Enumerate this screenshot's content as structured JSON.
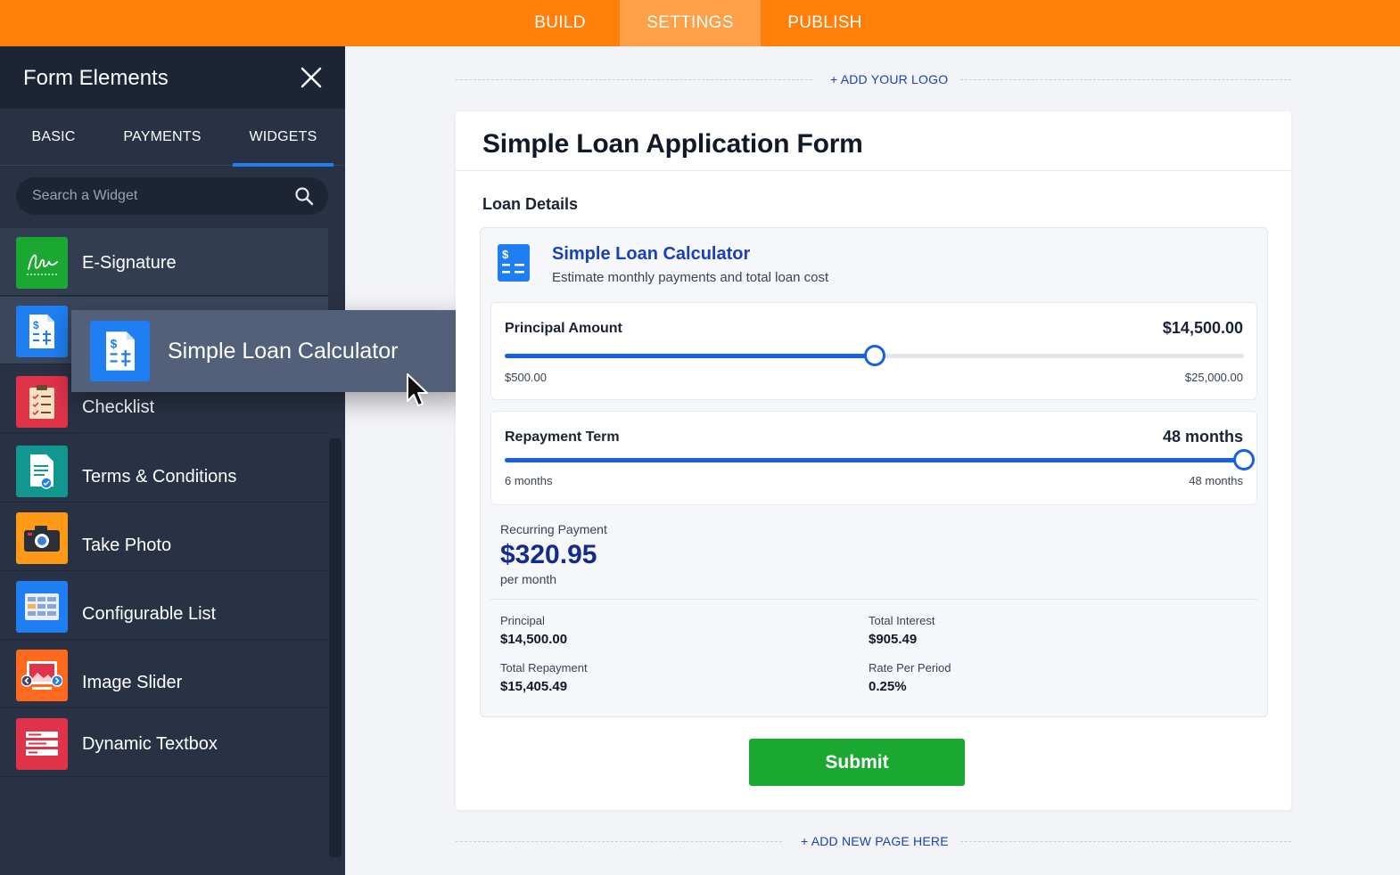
{
  "topnav": {
    "build": "BUILD",
    "settings": "SETTINGS",
    "publish": "PUBLISH",
    "active": "SETTINGS"
  },
  "sidebar": {
    "title": "Form Elements",
    "tabs": [
      "BASIC",
      "PAYMENTS",
      "WIDGETS"
    ],
    "active_tab": "WIDGETS",
    "search_placeholder": "Search a Widget",
    "items": [
      {
        "label": "E-Signature",
        "icon": "signature-icon",
        "color": "#1ba832"
      },
      {
        "label": "Simple Loan Calculator",
        "icon": "loan-calculator-icon",
        "color": "#1f7ff2"
      },
      {
        "label": "Checklist",
        "icon": "clipboard-checklist-icon",
        "color": "#e0334a"
      },
      {
        "label": "Terms & Conditions",
        "icon": "terms-document-icon",
        "color": "#11978f"
      },
      {
        "label": "Take Photo",
        "icon": "camera-icon",
        "color": "#ff9a17"
      },
      {
        "label": "Configurable List",
        "icon": "list-grid-icon",
        "color": "#1f7ff2"
      },
      {
        "label": "Image Slider",
        "icon": "image-slider-icon",
        "color": "#ff6a1f"
      },
      {
        "label": "Dynamic Textbox",
        "icon": "dynamic-textbox-icon",
        "color": "#e0334a"
      }
    ]
  },
  "drag_ghost": {
    "label": "Simple Loan Calculator",
    "icon": "loan-calculator-icon"
  },
  "form": {
    "add_logo": "+ ADD YOUR LOGO",
    "title": "Simple Loan Application Form",
    "section": "Loan Details",
    "add_page": "+ ADD NEW PAGE HERE",
    "submit": "Submit"
  },
  "calculator": {
    "title": "Simple Loan Calculator",
    "subtitle": "Estimate monthly payments and total loan cost",
    "principal": {
      "label": "Principal Amount",
      "value": "$14,500.00",
      "min": "$500.00",
      "max": "$25,000.00",
      "fraction": 0.5
    },
    "term": {
      "label": "Repayment Term",
      "value": "48 months",
      "min": "6 months",
      "max": "48 months",
      "fraction": 1.0
    },
    "recurring": {
      "label": "Recurring Payment",
      "amount": "$320.95",
      "period": "per month"
    },
    "stats": {
      "principal_label": "Principal",
      "principal_value": "$14,500.00",
      "interest_label": "Total Interest",
      "interest_value": "$905.49",
      "repayment_label": "Total Repayment",
      "repayment_value": "$15,405.49",
      "rate_label": "Rate Per Period",
      "rate_value": "0.25%"
    }
  },
  "colors": {
    "accent_orange": "#ff7f0a",
    "accent_blue": "#1660e8",
    "submit_green": "#1ba832",
    "sidebar_bg": "#293244"
  }
}
